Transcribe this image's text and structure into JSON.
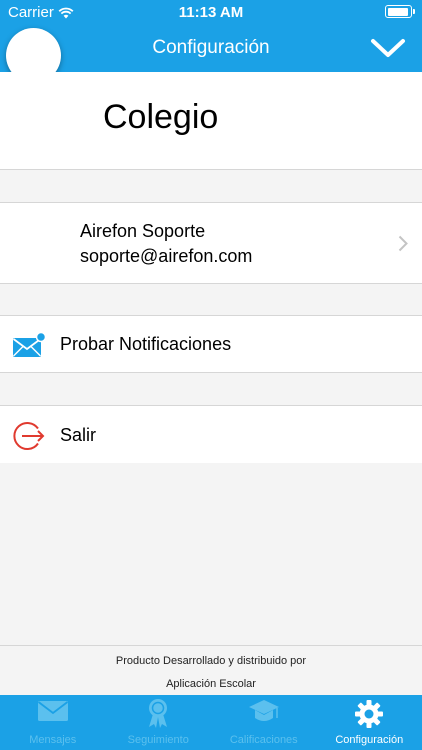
{
  "status_bar": {
    "carrier": "Carrier",
    "time": "11:13 AM"
  },
  "nav": {
    "title": "Configuración"
  },
  "school": {
    "name": "Colegio"
  },
  "user": {
    "name": "Airefon Soporte",
    "email": "soporte@airefon.com"
  },
  "notifications": {
    "label": "Probar Notificaciones"
  },
  "logout": {
    "label": "Salir"
  },
  "footer": {
    "line1": "Producto Desarrollado y distribuido por",
    "line2": "Aplicación Escolar"
  },
  "tabs": [
    {
      "label": "Mensajes",
      "icon": "envelope-icon"
    },
    {
      "label": "Seguimiento",
      "icon": "ribbon-icon"
    },
    {
      "label": "Calificaciones",
      "icon": "graduation-cap-icon"
    },
    {
      "label": "Configuración",
      "icon": "gear-icon",
      "active": true
    }
  ],
  "colors": {
    "primary": "#1ba1e6",
    "logout_red": "#e03a2f",
    "background": "#f4f4f4"
  }
}
